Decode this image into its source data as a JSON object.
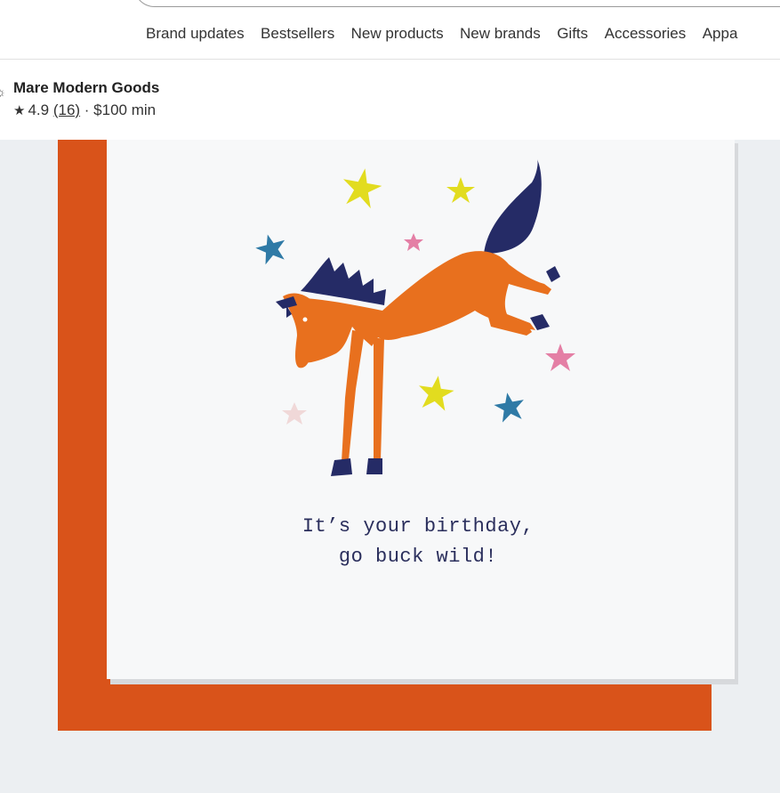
{
  "nav": {
    "items": [
      "Brand updates",
      "Bestsellers",
      "New products",
      "New brands",
      "Gifts",
      "Accessories",
      "Appa"
    ]
  },
  "brand": {
    "name": "Mare Modern Goods",
    "rating": "4.9",
    "review_count": "(16)",
    "separator": " · ",
    "minimum": "$100 min"
  },
  "card": {
    "line1": "It’s your birthday,",
    "line2": "go buck wild!"
  },
  "colors": {
    "envelope": "#d9531a",
    "horse": "#e8701e",
    "mane": "#252b66",
    "star_yellow": "#e2dc1f",
    "star_blue": "#2f7aa6",
    "star_pink": "#e47fa5"
  }
}
